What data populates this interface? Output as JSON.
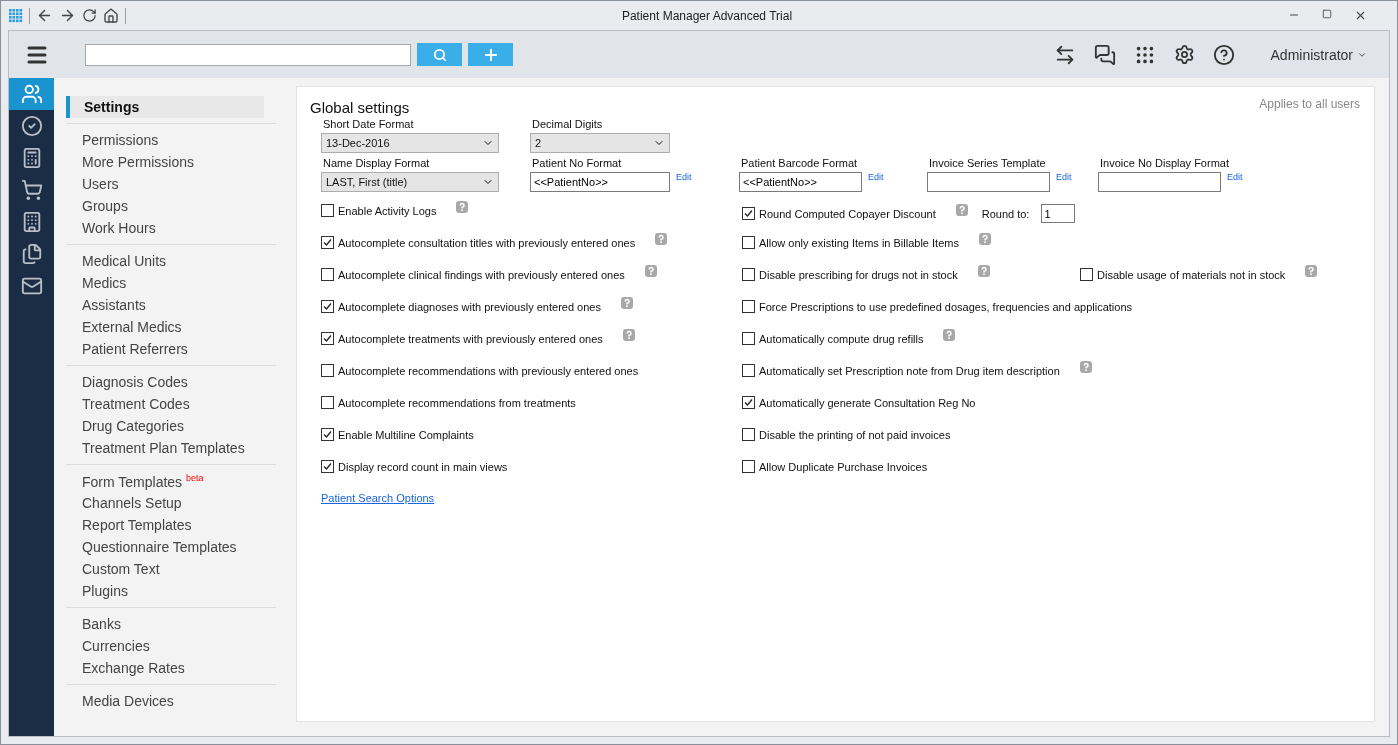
{
  "window": {
    "title": "Patient Manager Advanced Trial"
  },
  "toolbar": {
    "user": "Administrator"
  },
  "nav_rail": [
    {
      "selected": true
    },
    {
      "selected": false
    },
    {
      "selected": false
    },
    {
      "selected": false
    },
    {
      "selected": false
    },
    {
      "selected": false
    },
    {
      "selected": false
    }
  ],
  "sidebar": {
    "header": {
      "label": "Settings",
      "selected": true
    },
    "groups": [
      [
        {
          "label": "Permissions"
        },
        {
          "label": "More Permissions"
        },
        {
          "label": "Users"
        },
        {
          "label": "Groups"
        },
        {
          "label": "Work Hours"
        }
      ],
      [
        {
          "label": "Medical Units"
        },
        {
          "label": "Medics"
        },
        {
          "label": "Assistants"
        },
        {
          "label": "External Medics"
        },
        {
          "label": "Patient Referrers"
        }
      ],
      [
        {
          "label": "Diagnosis Codes"
        },
        {
          "label": "Treatment Codes"
        },
        {
          "label": "Drug Categories"
        },
        {
          "label": "Treatment Plan Templates"
        }
      ],
      [
        {
          "label": "Form Templates",
          "badge": "beta"
        },
        {
          "label": "Channels Setup"
        },
        {
          "label": "Report Templates"
        },
        {
          "label": "Questionnaire Templates"
        },
        {
          "label": "Custom Text"
        },
        {
          "label": "Plugins"
        }
      ],
      [
        {
          "label": "Banks"
        },
        {
          "label": "Currencies"
        },
        {
          "label": "Exchange Rates"
        }
      ],
      [
        {
          "label": "Media Devices"
        }
      ]
    ]
  },
  "panel": {
    "title": "Global settings",
    "note": "Applies to all users",
    "field_rows": [
      [
        {
          "label": "Short Date Format",
          "kind": "dropdown",
          "value": "13-Dec-2016"
        },
        {
          "label": "Decimal Digits",
          "kind": "dropdown",
          "value": "2"
        }
      ],
      [
        {
          "label": "Name Display Format",
          "kind": "dropdown",
          "value": "LAST, First (title)"
        },
        {
          "label": "Patient No Format",
          "kind": "text",
          "value": "<<PatientNo>>",
          "edit": "Edit"
        },
        {
          "label": "Patient Barcode Format",
          "kind": "text",
          "value": "<<PatientNo>>",
          "edit": "Edit"
        },
        {
          "label": "Invoice Series Template",
          "kind": "text",
          "edit": "Edit"
        },
        {
          "label": "Invoice No Display Format",
          "kind": "text",
          "edit": "Edit"
        }
      ]
    ],
    "options": [
      {
        "left": {
          "label": "Enable Activity Logs",
          "checked": false,
          "help": true
        },
        "right": {
          "label": "Round Computed Copayer Discount",
          "checked": true,
          "help": true,
          "round_label": "Round to:",
          "round_value": "1"
        }
      },
      {
        "left": {
          "label": "Autocomplete consultation titles with previously entered ones",
          "checked": true,
          "help": true
        },
        "right": {
          "label": "Allow only existing Items in Billable Items",
          "checked": false,
          "help": true
        }
      },
      {
        "left": {
          "label": "Autocomplete clinical findings with previously entered ones",
          "checked": false,
          "help": true
        },
        "right": {
          "label": "Disable prescribing for drugs not in stock",
          "checked": false,
          "help": true
        },
        "extra": {
          "label": "Disable usage of materials not in stock",
          "checked": false,
          "help": true
        }
      },
      {
        "left": {
          "label": "Autocomplete diagnoses with previously entered ones",
          "checked": true,
          "help": true
        },
        "right": {
          "label": "Force Prescriptions to use predefined dosages, frequencies and applications",
          "checked": false,
          "help": false
        }
      },
      {
        "left": {
          "label": "Autocomplete treatments with previously entered ones",
          "checked": true,
          "help": true
        },
        "right": {
          "label": "Automatically compute drug refills",
          "checked": false,
          "help": true
        }
      },
      {
        "left": {
          "label": "Autocomplete recommendations with previously entered ones",
          "checked": false,
          "help": false
        },
        "right": {
          "label": "Automatically set Prescription note from Drug item description",
          "checked": false,
          "help": true
        }
      },
      {
        "left": {
          "label": "Autocomplete recommendations from treatments",
          "checked": false,
          "help": false
        },
        "right": {
          "label": "Automatically generate Consultation Reg No",
          "checked": true,
          "help": false
        }
      },
      {
        "left": {
          "label": "Enable Multiline Complaints",
          "checked": true,
          "help": false
        },
        "right": {
          "label": "Disable the printing of not paid invoices",
          "checked": false,
          "help": false
        }
      },
      {
        "left": {
          "label": "Display record count in main views",
          "checked": true,
          "help": false
        },
        "right": {
          "label": "Allow Duplicate Purchase Invoices",
          "checked": false,
          "help": false
        }
      }
    ],
    "link": "Patient Search Options"
  }
}
